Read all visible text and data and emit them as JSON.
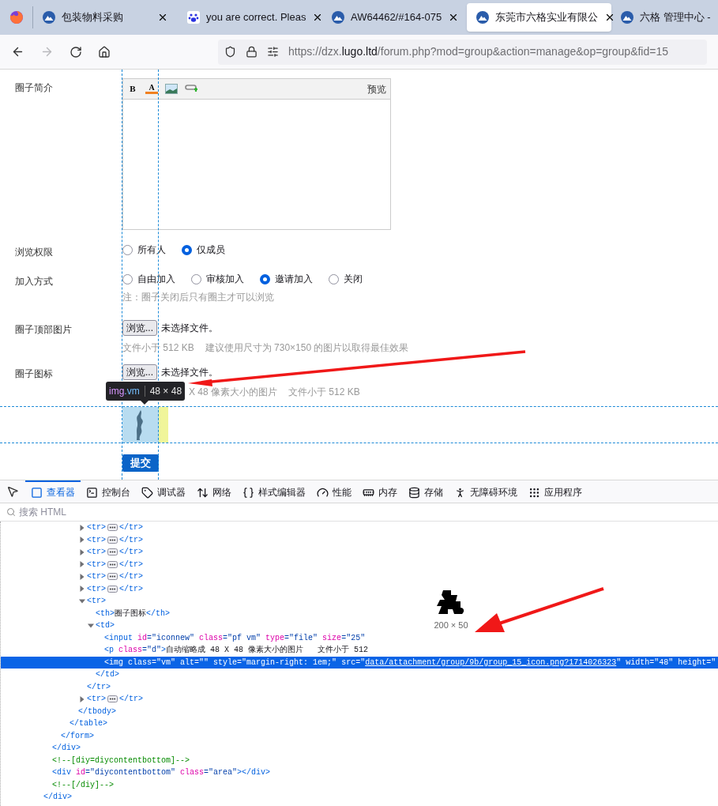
{
  "browser": {
    "tabs": [
      {
        "title": "包装物料采购",
        "selected": false,
        "closable": true
      },
      {
        "title": "you are correct. Pleas",
        "selected": false,
        "closable": true
      },
      {
        "title": "AW64462/#164-075",
        "selected": false,
        "closable": true
      },
      {
        "title": "东莞市六格实业有限公",
        "selected": true,
        "closable": true
      },
      {
        "title": "六格 管理中心 -",
        "selected": false,
        "closable": false
      }
    ],
    "nav": {
      "forward_disabled": true
    },
    "url": {
      "prefix": "https://dzx.",
      "host": "lugo.ltd",
      "path": "/forum.php?mod=group&action=manage&op=group&fid=15"
    }
  },
  "form": {
    "fields": [
      {
        "kind": "editor",
        "label": "圈子简介",
        "tools": [
          {
            "kind": "bold",
            "label": "B"
          },
          {
            "kind": "color",
            "label": "A"
          },
          {
            "kind": "image"
          },
          {
            "kind": "link"
          }
        ],
        "preview": "预览"
      },
      {
        "kind": "radio",
        "label": "浏览权限",
        "options": [
          {
            "label": "所有人",
            "selected": false
          },
          {
            "label": "仅成员",
            "selected": true
          }
        ]
      },
      {
        "kind": "radio",
        "label": "加入方式",
        "options": [
          {
            "label": "自由加入",
            "selected": false
          },
          {
            "label": "审核加入",
            "selected": false
          },
          {
            "label": "邀请加入",
            "selected": true
          },
          {
            "label": "关闭",
            "selected": false
          }
        ],
        "note": "注：圈子关闭后只有圈主才可以浏览"
      },
      {
        "kind": "file",
        "label": "圈子顶部图片",
        "button": "浏览...",
        "status": "未选择文件。",
        "hint": [
          "文件小于 512 KB",
          "建议使用尺寸为 730×150 的图片以取得最佳效果"
        ]
      },
      {
        "kind": "file",
        "label": "圈子图标",
        "button": "浏览...",
        "status": "未选择文件。",
        "hint": [
          "X 48 像素大小的图片",
          "文件小于 512 KB"
        ]
      }
    ],
    "submit": "提交",
    "tooltip": {
      "tag": "img",
      "cls": ".vm",
      "size": "48 × 48"
    }
  },
  "devtools": {
    "tabs": [
      {
        "label": "查看器",
        "selected": true
      },
      {
        "label": "控制台",
        "selected": false
      },
      {
        "label": "调试器",
        "selected": false
      },
      {
        "label": "网络",
        "selected": false
      },
      {
        "label": "样式编辑器",
        "selected": false
      },
      {
        "label": "性能",
        "selected": false
      },
      {
        "label": "内存",
        "selected": false
      },
      {
        "label": "存储",
        "selected": false
      },
      {
        "label": "无障碍环境",
        "selected": false
      },
      {
        "label": "应用程序",
        "selected": false
      }
    ],
    "search": {
      "placeholder": "搜索 HTML"
    },
    "preview": {
      "size": "200 × 50"
    },
    "nodes": [
      {
        "selected": false,
        "close": [
          {
            "kind": "t",
            "text": "</div>"
          }
        ],
        "children": [
          {
            "selected": false,
            "close": [
              {
                "kind": "t",
                "text": "</div>"
              }
            ],
            "children": [
              {
                "selected": false,
                "close": [
                  {
                    "kind": "t",
                    "text": "</form>"
                  }
                ],
                "children": [
                  {
                    "selected": false,
                    "close": [
                      {
                        "kind": "t",
                        "text": "</table>"
                      }
                    ],
                    "children": [
                      {
                        "selected": false,
                        "close": [
                          {
                            "kind": "t",
                            "text": "</tbody>"
                          }
                        ],
                        "children": [
                          {
                            "open": [
                              {
                                "kind": "t",
                                "text": "<tr>"
                              }
                            ],
                            "close": [
                              {
                                "kind": "t",
                                "text": "</tr>"
                              }
                            ],
                            "expanded": false,
                            "selected": false
                          },
                          {
                            "open": [
                              {
                                "kind": "t",
                                "text": "<tr>"
                              }
                            ],
                            "close": [
                              {
                                "kind": "t",
                                "text": "</tr>"
                              }
                            ],
                            "expanded": false,
                            "selected": false
                          },
                          {
                            "open": [
                              {
                                "kind": "t",
                                "text": "<tr>"
                              }
                            ],
                            "close": [
                              {
                                "kind": "t",
                                "text": "</tr>"
                              }
                            ],
                            "expanded": false,
                            "selected": false
                          },
                          {
                            "open": [
                              {
                                "kind": "t",
                                "text": "<tr>"
                              }
                            ],
                            "close": [
                              {
                                "kind": "t",
                                "text": "</tr>"
                              }
                            ],
                            "expanded": false,
                            "selected": false
                          },
                          {
                            "open": [
                              {
                                "kind": "t",
                                "text": "<tr>"
                              }
                            ],
                            "close": [
                              {
                                "kind": "t",
                                "text": "</tr>"
                              }
                            ],
                            "expanded": false,
                            "selected": false
                          },
                          {
                            "open": [
                              {
                                "kind": "t",
                                "text": "<tr>"
                              }
                            ],
                            "close": [
                              {
                                "kind": "t",
                                "text": "</tr>"
                              }
                            ],
                            "expanded": false,
                            "selected": false
                          },
                          {
                            "open": [
                              {
                                "kind": "t",
                                "text": "<tr>"
                              }
                            ],
                            "close": [
                              {
                                "kind": "t",
                                "text": "</tr>"
                              }
                            ],
                            "expanded": true,
                            "selected": false,
                            "children": [
                              {
                                "open": [
                                  {
                                    "kind": "t",
                                    "text": "<th>"
                                  },
                                  {
                                    "kind": "x",
                                    "text": "圈子图标"
                                  },
                                  {
                                    "kind": "t",
                                    "text": "</th>"
                                  }
                                ],
                                "selected": false
                              },
                              {
                                "open": [
                                  {
                                    "kind": "t",
                                    "text": "<td>"
                                  }
                                ],
                                "close": [
                                  {
                                    "kind": "t",
                                    "text": "</td>"
                                  }
                                ],
                                "expanded": true,
                                "selected": false,
                                "children": [
                                  {
                                    "open": [
                                      {
                                        "kind": "t",
                                        "text": "<input"
                                      },
                                      {
                                        "kind": "a",
                                        "text": " id"
                                      },
                                      {
                                        "kind": "v",
                                        "text": "=\"iconnew\""
                                      },
                                      {
                                        "kind": "a",
                                        "text": " class"
                                      },
                                      {
                                        "kind": "v",
                                        "text": "=\"pf vm\""
                                      },
                                      {
                                        "kind": "a",
                                        "text": " type"
                                      },
                                      {
                                        "kind": "v",
                                        "text": "=\"file\""
                                      },
                                      {
                                        "kind": "a",
                                        "text": " size"
                                      },
                                      {
                                        "kind": "v",
                                        "text": "=\"25\""
                                      }
                                    ],
                                    "selected": false
                                  },
                                  {
                                    "open": [
                                      {
                                        "kind": "t",
                                        "text": "<p"
                                      },
                                      {
                                        "kind": "a",
                                        "text": " class"
                                      },
                                      {
                                        "kind": "v",
                                        "text": "=\"d\""
                                      },
                                      {
                                        "kind": "t",
                                        "text": ">"
                                      },
                                      {
                                        "kind": "x",
                                        "text": "自动缩略成 48 X 48 像素大小的图片   文件小于 512"
                                      }
                                    ],
                                    "selected": false
                                  },
                                  {
                                    "open": [
                                      {
                                        "kind": "t",
                                        "text": "<img"
                                      },
                                      {
                                        "kind": "a",
                                        "text": " class"
                                      },
                                      {
                                        "kind": "v",
                                        "text": "=\"vm\""
                                      },
                                      {
                                        "kind": "a",
                                        "text": " alt"
                                      },
                                      {
                                        "kind": "v",
                                        "text": "=\"\""
                                      },
                                      {
                                        "kind": "a",
                                        "text": " style"
                                      },
                                      {
                                        "kind": "v",
                                        "text": "=\"margin-right: 1em;\""
                                      },
                                      {
                                        "kind": "a",
                                        "text": " src"
                                      },
                                      {
                                        "kind": "v",
                                        "text": "=\""
                                      },
                                      {
                                        "kind": "l",
                                        "text": "data/attachment/group/9b/group_15_icon.png?1714026323"
                                      },
                                      {
                                        "kind": "v",
                                        "text": "\""
                                      },
                                      {
                                        "kind": "a",
                                        "text": " width"
                                      },
                                      {
                                        "kind": "v",
                                        "text": "=\"48\""
                                      },
                                      {
                                        "kind": "a",
                                        "text": " height"
                                      },
                                      {
                                        "kind": "v",
                                        "text": "=\""
                                      }
                                    ],
                                    "selected": true
                                  }
                                ]
                              }
                            ]
                          },
                          {
                            "open": [
                              {
                                "kind": "t",
                                "text": "<tr>"
                              }
                            ],
                            "close": [
                              {
                                "kind": "t",
                                "text": "</tr>"
                              }
                            ],
                            "expanded": false,
                            "selected": false
                          }
                        ]
                      }
                    ]
                  }
                ]
              }
            ]
          },
          {
            "open": [
              {
                "kind": "c",
                "text": "<!--[diy=diycontentbottom]-->"
              }
            ],
            "selected": false
          },
          {
            "open": [
              {
                "kind": "t",
                "text": "<div"
              },
              {
                "kind": "a",
                "text": " id"
              },
              {
                "kind": "v",
                "text": "=\"diycontentbottom\""
              },
              {
                "kind": "a",
                "text": " class"
              },
              {
                "kind": "v",
                "text": "=\"area\""
              },
              {
                "kind": "t",
                "text": "></div>"
              }
            ],
            "selected": false
          },
          {
            "open": [
              {
                "kind": "c",
                "text": "<!--[/diy]-->"
              }
            ],
            "selected": false
          }
        ]
      }
    ]
  }
}
